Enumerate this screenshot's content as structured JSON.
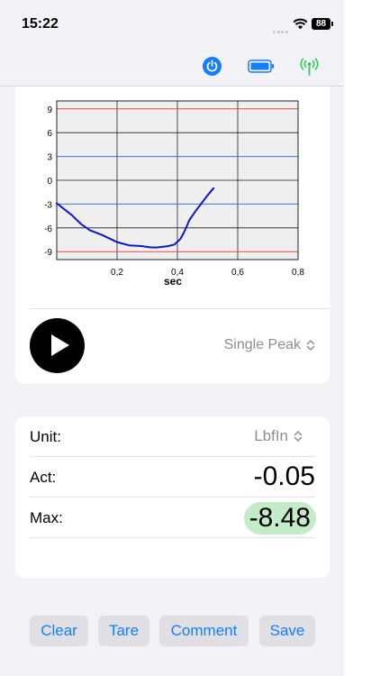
{
  "status": {
    "time": "15:22",
    "battery": "88"
  },
  "chart_data": {
    "type": "line",
    "title": "",
    "xlabel": "sec",
    "ylabel": "",
    "xlim": [
      0,
      0.8
    ],
    "ylim": [
      -10,
      10
    ],
    "x_ticks": [
      0.2,
      0.4,
      0.6,
      0.8
    ],
    "x_tick_labels": [
      "0,2",
      "0,4",
      "0,6",
      "0,8"
    ],
    "y_ticks": [
      9,
      6,
      3,
      0,
      -3,
      -6,
      -9
    ],
    "y_tick_labels": [
      "9",
      "6",
      "3",
      "0",
      "-3",
      "-6",
      "-9"
    ],
    "grid": true,
    "reference_lines": [
      {
        "y": 9,
        "color": "#e8484a"
      },
      {
        "y": 3,
        "color": "#3a78d6"
      },
      {
        "y": -3,
        "color": "#3a78d6"
      },
      {
        "y": -9,
        "color": "#e8484a"
      }
    ],
    "series": [
      {
        "color": "#0b17c9",
        "x": [
          0,
          0.02,
          0.05,
          0.08,
          0.11,
          0.15,
          0.2,
          0.24,
          0.28,
          0.31,
          0.33,
          0.35,
          0.37,
          0.39,
          0.41,
          0.42,
          0.43,
          0.44,
          0.46,
          0.48,
          0.5,
          0.52
        ],
        "y": [
          -2.9,
          -3.5,
          -4.4,
          -5.5,
          -6.3,
          -6.9,
          -7.8,
          -8.2,
          -8.3,
          -8.45,
          -8.48,
          -8.4,
          -8.3,
          -8.1,
          -7.4,
          -6.7,
          -5.9,
          -5.0,
          -3.9,
          -2.9,
          -1.9,
          -1.0
        ]
      }
    ]
  },
  "controls": {
    "mode": "Single Peak"
  },
  "readings": {
    "unit_label": "Unit:",
    "unit_value": "LbfIn",
    "act_label": "Act:",
    "act_value": "-0.05",
    "max_label": "Max:",
    "max_value": "-8.48"
  },
  "actions": {
    "clear": "Clear",
    "tare": "Tare",
    "comment": "Comment",
    "save": "Save"
  },
  "colors": {
    "accent": "#147efb",
    "max_highlight": "#c4ecc9",
    "antenna": "#34c759"
  },
  "icons": [
    "wifi-icon",
    "power-icon",
    "battery-icon",
    "antenna-icon",
    "play-icon",
    "chevron-updown-icon"
  ]
}
